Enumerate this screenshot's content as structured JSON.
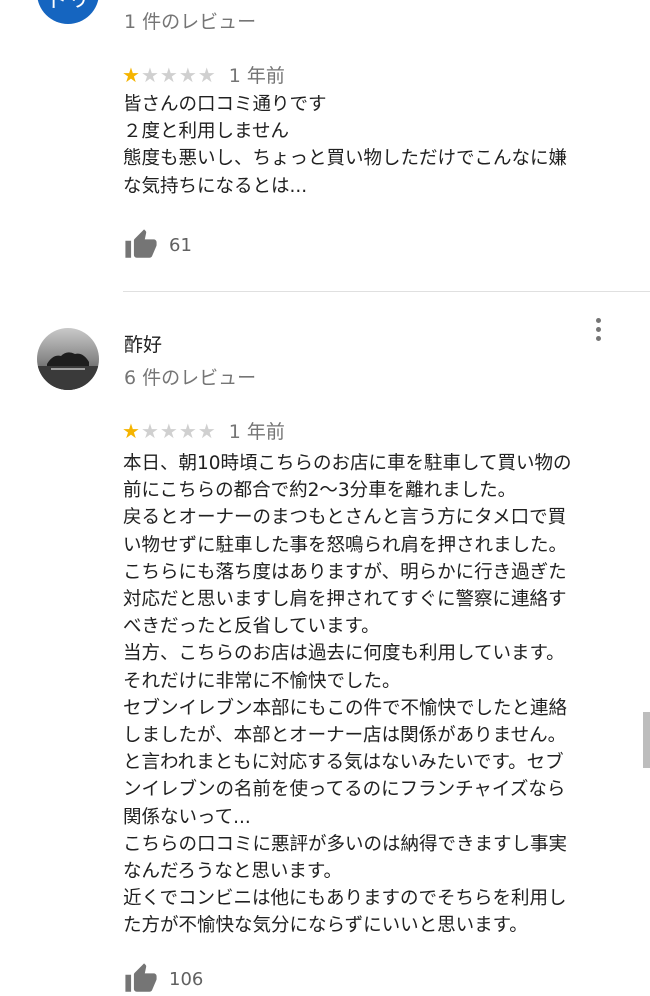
{
  "review1": {
    "avatar_text": "ドリ",
    "review_count": "1 件のレビュー",
    "rating": 1,
    "max_rating": 5,
    "date": "1 年前",
    "lines": [
      "皆さんの口コミ通りです",
      "２度と利用しません",
      "態度も悪いし、ちょっと買い物しただけでこんなに嫌",
      "な気持ちになるとは..."
    ],
    "likes": "61"
  },
  "review2": {
    "author": "酢好",
    "review_count": "6 件のレビュー",
    "rating": 1,
    "max_rating": 5,
    "date": "1 年前",
    "lines": [
      "本日、朝10時頃こちらのお店に車を駐車して買い物の",
      "前にこちらの都合で約2〜3分車を離れました。",
      "戻るとオーナーのまつもとさんと言う方にタメ口で買",
      "い物せずに駐車した事を怒鳴られ肩を押されました。",
      "こちらにも落ち度はありますが、明らかに行き過ぎた",
      "対応だと思いますし肩を押されてすぐに警察に連絡す",
      "べきだったと反省しています。",
      "当方、こちらのお店は過去に何度も利用しています。",
      "それだけに非常に不愉快でした。",
      "セブンイレブン本部にもこの件で不愉快でしたと連絡",
      "しましたが、本部とオーナー店は関係がありません。",
      "と言われまともに対応する気はないみたいです。セブ",
      "ンイレブンの名前を使ってるのにフランチャイズなら",
      "関係ないって...",
      "こちらの口コミに悪評が多いのは納得できますし事実",
      "なんだろうなと思います。",
      "近くでコンビニは他にもありますのでそちらを利用し",
      "た方が不愉快な気分にならずにいいと思います。"
    ],
    "likes": "106"
  },
  "colors": {
    "star_on": "#f5b400",
    "star_off": "#d0d0d0",
    "avatar_blue": "#1565c0"
  }
}
